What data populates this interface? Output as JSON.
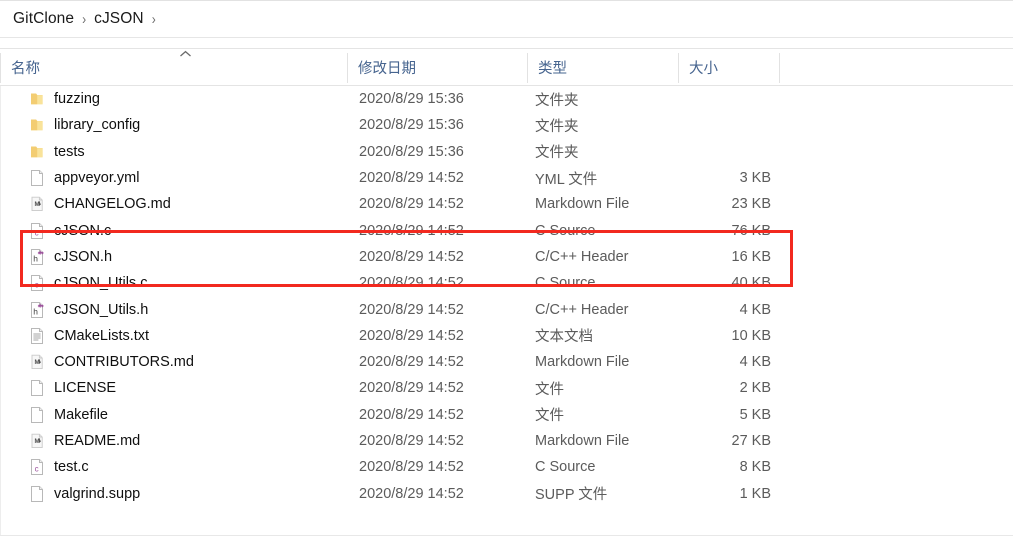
{
  "breadcrumb": {
    "items": [
      {
        "label": "GitClone"
      },
      {
        "label": "cJSON"
      }
    ],
    "separator": "›"
  },
  "columns": {
    "name": "名称",
    "date_modified": "修改日期",
    "type": "类型",
    "size": "大小",
    "sort_indicator": "ascending"
  },
  "files": [
    {
      "name": "fuzzing",
      "date": "2020/8/29 15:36",
      "type": "文件夹",
      "size": "",
      "icon": "folder-icon",
      "highlighted": false
    },
    {
      "name": "library_config",
      "date": "2020/8/29 15:36",
      "type": "文件夹",
      "size": "",
      "icon": "folder-icon",
      "highlighted": false
    },
    {
      "name": "tests",
      "date": "2020/8/29 15:36",
      "type": "文件夹",
      "size": "",
      "icon": "folder-icon",
      "highlighted": false
    },
    {
      "name": "appveyor.yml",
      "date": "2020/8/29 14:52",
      "type": "YML 文件",
      "size": "3 KB",
      "icon": "blank-file-icon",
      "highlighted": false
    },
    {
      "name": "CHANGELOG.md",
      "date": "2020/8/29 14:52",
      "type": "Markdown File",
      "size": "23 KB",
      "icon": "markdown-file-icon",
      "highlighted": false
    },
    {
      "name": "cJSON.c",
      "date": "2020/8/29 14:52",
      "type": "C Source",
      "size": "76 KB",
      "icon": "c-source-icon",
      "highlighted": true
    },
    {
      "name": "cJSON.h",
      "date": "2020/8/29 14:52",
      "type": "C/C++ Header",
      "size": "16 KB",
      "icon": "c-header-icon",
      "highlighted": true
    },
    {
      "name": "cJSON_Utils.c",
      "date": "2020/8/29 14:52",
      "type": "C Source",
      "size": "40 KB",
      "icon": "c-source-icon",
      "highlighted": false
    },
    {
      "name": "cJSON_Utils.h",
      "date": "2020/8/29 14:52",
      "type": "C/C++ Header",
      "size": "4 KB",
      "icon": "c-header-icon",
      "highlighted": false
    },
    {
      "name": "CMakeLists.txt",
      "date": "2020/8/29 14:52",
      "type": "文本文档",
      "size": "10 KB",
      "icon": "text-file-icon",
      "highlighted": false
    },
    {
      "name": "CONTRIBUTORS.md",
      "date": "2020/8/29 14:52",
      "type": "Markdown File",
      "size": "4 KB",
      "icon": "markdown-file-icon",
      "highlighted": false
    },
    {
      "name": "LICENSE",
      "date": "2020/8/29 14:52",
      "type": "文件",
      "size": "2 KB",
      "icon": "blank-file-icon",
      "highlighted": false
    },
    {
      "name": "Makefile",
      "date": "2020/8/29 14:52",
      "type": "文件",
      "size": "5 KB",
      "icon": "blank-file-icon",
      "highlighted": false
    },
    {
      "name": "README.md",
      "date": "2020/8/29 14:52",
      "type": "Markdown File",
      "size": "27 KB",
      "icon": "markdown-file-icon",
      "highlighted": false
    },
    {
      "name": "test.c",
      "date": "2020/8/29 14:52",
      "type": "C Source",
      "size": "8 KB",
      "icon": "c-source-icon",
      "highlighted": false
    },
    {
      "name": "valgrind.supp",
      "date": "2020/8/29 14:52",
      "type": "SUPP 文件",
      "size": "1 KB",
      "icon": "blank-file-icon",
      "highlighted": false
    }
  ],
  "annotation": {
    "color": "#f2291f",
    "targets": [
      "cJSON.c",
      "cJSON.h"
    ]
  },
  "colors": {
    "header_text": "#46648f",
    "name_text": "#0f0f0f",
    "meta_text": "#5b5b5b",
    "folder": "#f7d77f",
    "accent_purple": "#9b4f9b",
    "annotation_red": "#f2291f"
  }
}
